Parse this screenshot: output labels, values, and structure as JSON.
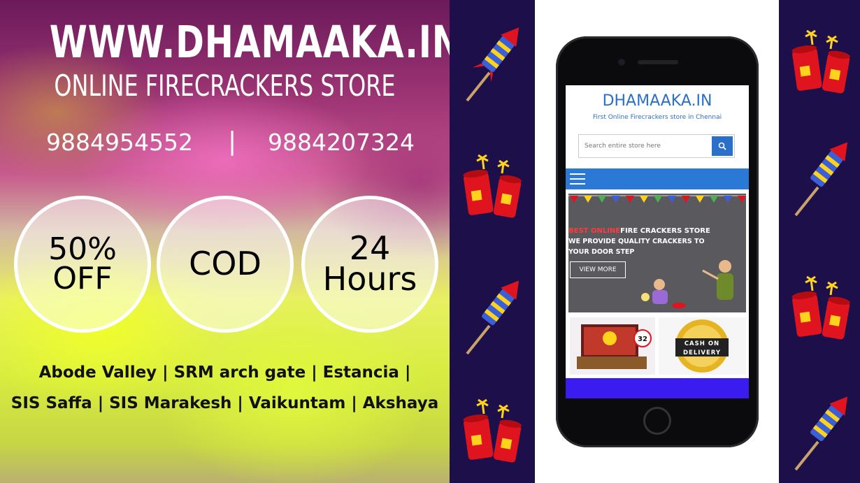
{
  "header": {
    "site": "WWW.DHAMAAKA.IN",
    "tagline": "ONLINE FIRECRACKERS STORE"
  },
  "contact": {
    "phone1": "9884954552",
    "separator": "|",
    "phone2": "9884207324"
  },
  "badges": [
    {
      "line1": "50%",
      "line2": "OFF"
    },
    {
      "line1": "COD",
      "line2": ""
    },
    {
      "line1": "24",
      "line2": "Hours"
    }
  ],
  "locations": {
    "line1": "Abode Valley | SRM arch gate | Estancia |",
    "line2": "SIS Saffa | SIS Marakesh | Vaikuntam | Akshaya"
  },
  "phone_screen": {
    "brand": "DHAMAAKA.IN",
    "subtitle": "First Online Firecrackers store in Chennai",
    "search_placeholder": "Search entire store here",
    "banner_red": "BEST ONLINE",
    "banner_white": "FIRE CRACKERS STORE",
    "banner_line2": "WE PROVIDE QUALITY CRACKERS TO",
    "banner_line3": "YOUR DOOR STEP",
    "view_more": "VIEW MORE",
    "cod_tile": "CASH ON DELIVERY",
    "tile_badge": "32"
  },
  "colors": {
    "navy": "#1d0f4a",
    "brand_blue": "#2a6fc9",
    "cracker_red": "#e0141e",
    "rocket_blue": "#3b5fd6",
    "accent_yellow": "#ffd21c"
  },
  "icons": [
    "rocket-icon",
    "firecracker-icon",
    "search-icon",
    "menu-icon"
  ]
}
